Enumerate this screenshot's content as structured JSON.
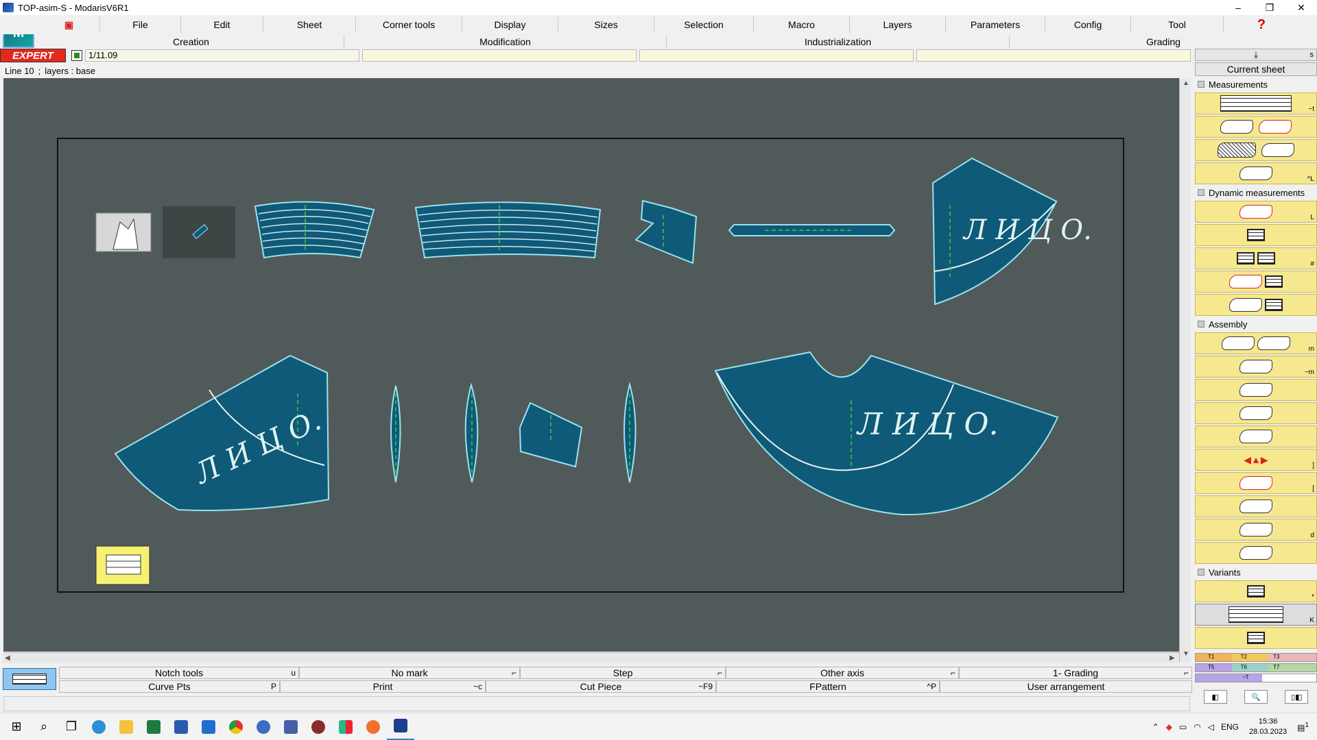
{
  "window": {
    "title": "TOP-asim-S - ModarisV6R1",
    "min": "–",
    "max": "❐",
    "close": "✕"
  },
  "menu": [
    "File",
    "Edit",
    "Sheet",
    "Corner tools",
    "Display",
    "Sizes",
    "Selection",
    "Macro",
    "Layers",
    "Parameters",
    "Config",
    "Tool"
  ],
  "submenu": [
    "Creation",
    "Modification",
    "Industrialization",
    "Grading"
  ],
  "expert": {
    "label": "EXPERT",
    "page": "1/11.09"
  },
  "status": {
    "line": "Line 10",
    "sep": ";",
    "layers": "layers : base"
  },
  "pieces": {
    "label": "Л И Ц О."
  },
  "right_panel": {
    "top_key": "s",
    "current_sheet": "Current sheet",
    "sections": {
      "measurements": "Measurements",
      "dynamic": "Dynamic measurements",
      "assembly": "Assembly",
      "variants": "Variants"
    },
    "keys": {
      "t": "~t",
      "L1": "^L",
      "L2": "L",
      "hash": "#",
      "m1": "m",
      "m2": "~m",
      "br1": "]",
      "br2": "[",
      "d": "d",
      "star": "*",
      "K": "K"
    },
    "sizes": {
      "row1": [
        "T1",
        "T2",
        "T3"
      ],
      "row2": [
        "T5",
        "T6",
        "T7"
      ],
      "row3": "~T"
    },
    "zoom": [
      "◧",
      "🔍",
      "▯◧"
    ]
  },
  "bottom_toolbar": {
    "row1": [
      {
        "label": "Notch tools",
        "key": "u"
      },
      {
        "label": "No mark",
        "key": "⌐"
      },
      {
        "label": "Step",
        "key": "⌐"
      },
      {
        "label": "Other axis",
        "key": "⌐"
      },
      {
        "label": "1- Grading",
        "key": "⌐"
      }
    ],
    "row2": [
      {
        "label": "Curve Pts",
        "key": "P"
      },
      {
        "label": "Print",
        "key": "~c"
      },
      {
        "label": "Cut Piece",
        "key": "~F9"
      },
      {
        "label": "FPattern",
        "key": "^P"
      },
      {
        "label": "User arrangement",
        "key": ""
      }
    ]
  },
  "taskbar": {
    "lang": "ENG",
    "time": "15:36",
    "date": "28.03.2023",
    "notif": "1"
  }
}
